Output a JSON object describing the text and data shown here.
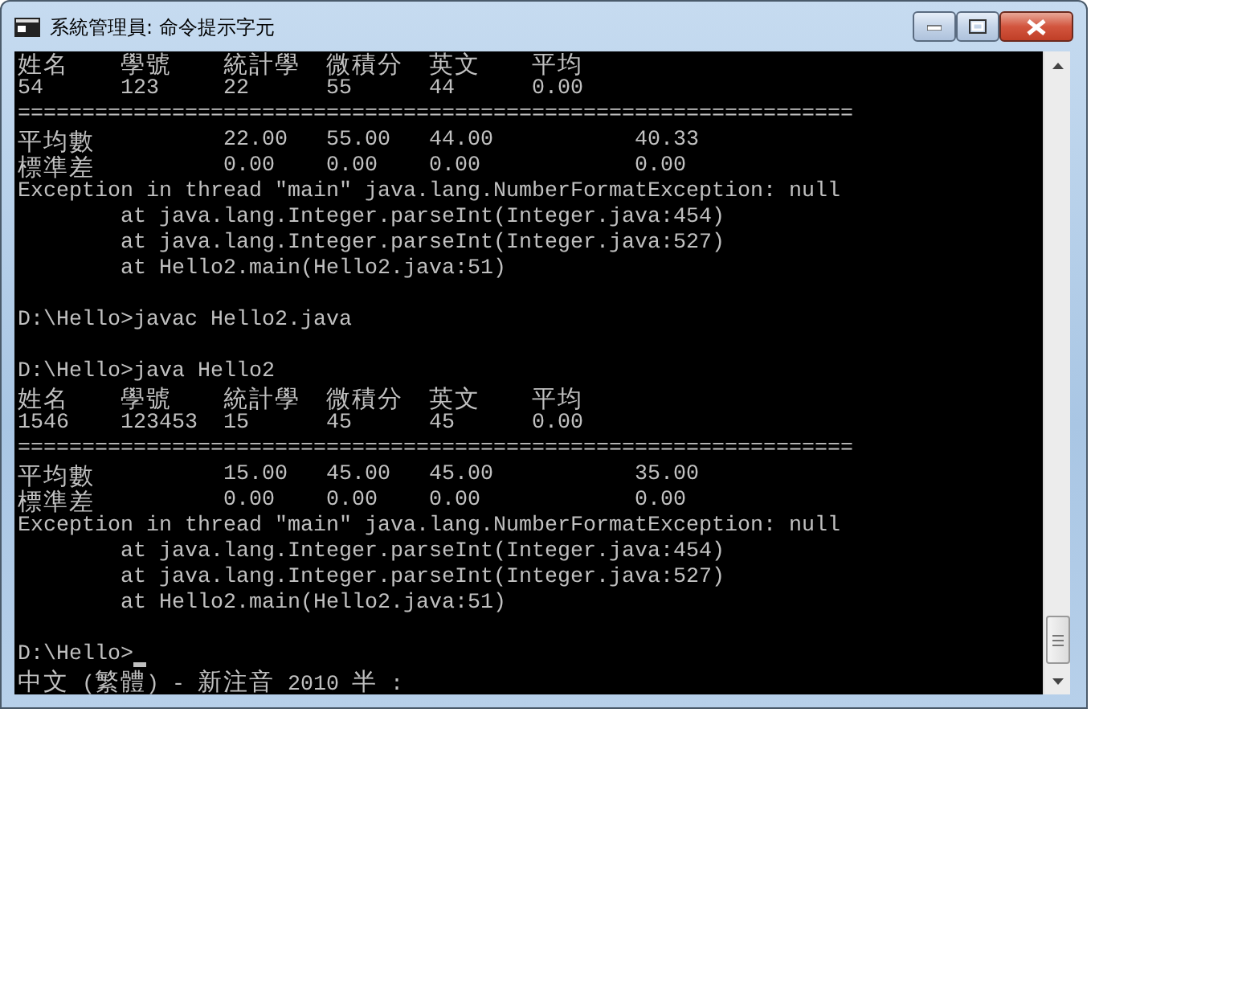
{
  "window": {
    "title": "系統管理員: 命令提示字元"
  },
  "console": {
    "lines": [
      {
        "kind": "row",
        "cells": [
          "姓名",
          "學號",
          "統計學",
          "微積分",
          "英文",
          "平均"
        ]
      },
      {
        "kind": "row",
        "cells": [
          "54",
          "123",
          "22",
          "55",
          "44",
          "0.00"
        ]
      },
      {
        "kind": "text",
        "text": "================================================================="
      },
      {
        "kind": "row",
        "cells": [
          "平均數",
          null,
          "22.00",
          "55.00",
          "44.00",
          null,
          "40.33"
        ]
      },
      {
        "kind": "row",
        "cells": [
          "標準差",
          null,
          "0.00",
          "0.00",
          "0.00",
          null,
          "0.00"
        ]
      },
      {
        "kind": "text",
        "text": "Exception in thread \"main\" java.lang.NumberFormatException: null"
      },
      {
        "kind": "text",
        "text": "        at java.lang.Integer.parseInt(Integer.java:454)"
      },
      {
        "kind": "text",
        "text": "        at java.lang.Integer.parseInt(Integer.java:527)"
      },
      {
        "kind": "text",
        "text": "        at Hello2.main(Hello2.java:51)"
      },
      {
        "kind": "blank"
      },
      {
        "kind": "text",
        "text": "D:\\Hello>javac Hello2.java"
      },
      {
        "kind": "blank"
      },
      {
        "kind": "text",
        "text": "D:\\Hello>java Hello2"
      },
      {
        "kind": "row",
        "cells": [
          "姓名",
          "學號",
          "統計學",
          "微積分",
          "英文",
          "平均"
        ]
      },
      {
        "kind": "row",
        "cells": [
          "1546",
          "123453",
          "15",
          "45",
          "45",
          "0.00"
        ]
      },
      {
        "kind": "text",
        "text": "================================================================="
      },
      {
        "kind": "row",
        "cells": [
          "平均數",
          null,
          "15.00",
          "45.00",
          "45.00",
          null,
          "35.00"
        ]
      },
      {
        "kind": "row",
        "cells": [
          "標準差",
          null,
          "0.00",
          "0.00",
          "0.00",
          null,
          "0.00"
        ]
      },
      {
        "kind": "text",
        "text": "Exception in thread \"main\" java.lang.NumberFormatException: null"
      },
      {
        "kind": "text",
        "text": "        at java.lang.Integer.parseInt(Integer.java:454)"
      },
      {
        "kind": "text",
        "text": "        at java.lang.Integer.parseInt(Integer.java:527)"
      },
      {
        "kind": "text",
        "text": "        at Hello2.main(Hello2.java:51)"
      },
      {
        "kind": "blank"
      },
      {
        "kind": "input",
        "text": "D:\\Hello>"
      }
    ]
  },
  "ime_status": "中文 (繁體) - 新注音 2010 半 :"
}
